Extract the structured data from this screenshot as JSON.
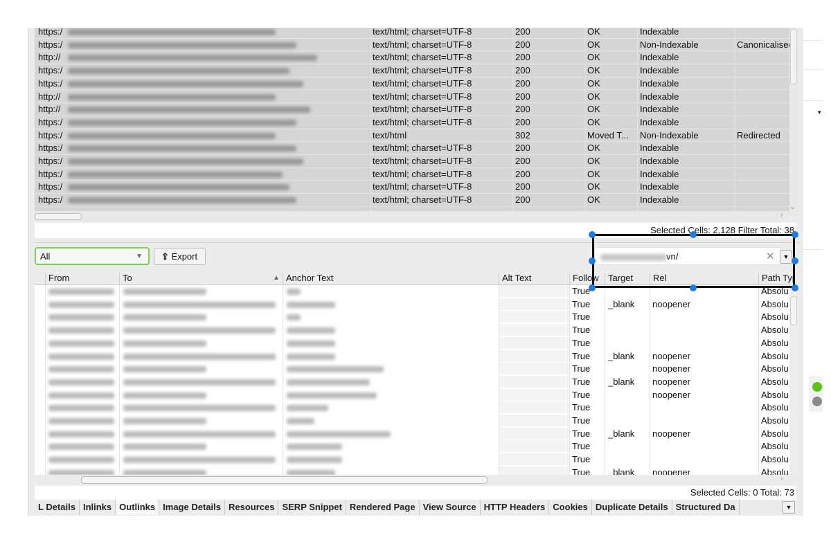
{
  "top_table": {
    "rows": [
      {
        "address": "https:/",
        "content_type": "text/html; charset=UTF-8",
        "status_code": "200",
        "status": "OK",
        "indexability": "Indexable",
        "indexability_status": ""
      },
      {
        "address": "https:/",
        "content_type": "text/html; charset=UTF-8",
        "status_code": "200",
        "status": "OK",
        "indexability": "Non-Indexable",
        "indexability_status": "Canonicalised"
      },
      {
        "address": "http://",
        "content_type": "text/html; charset=UTF-8",
        "status_code": "200",
        "status": "OK",
        "indexability": "Indexable",
        "indexability_status": ""
      },
      {
        "address": "https:/",
        "content_type": "text/html; charset=UTF-8",
        "status_code": "200",
        "status": "OK",
        "indexability": "Indexable",
        "indexability_status": ""
      },
      {
        "address": "https:/",
        "content_type": "text/html; charset=UTF-8",
        "status_code": "200",
        "status": "OK",
        "indexability": "Indexable",
        "indexability_status": ""
      },
      {
        "address": "http://",
        "content_type": "text/html; charset=UTF-8",
        "status_code": "200",
        "status": "OK",
        "indexability": "Indexable",
        "indexability_status": ""
      },
      {
        "address": "http://",
        "content_type": "text/html; charset=UTF-8",
        "status_code": "200",
        "status": "OK",
        "indexability": "Indexable",
        "indexability_status": ""
      },
      {
        "address": "https:/",
        "content_type": "text/html; charset=UTF-8",
        "status_code": "200",
        "status": "OK",
        "indexability": "Indexable",
        "indexability_status": ""
      },
      {
        "address": "https:/",
        "content_type": "text/html",
        "status_code": "302",
        "status": "Moved T...",
        "indexability": "Non-Indexable",
        "indexability_status": "Redirected"
      },
      {
        "address": "https:/",
        "content_type": "text/html; charset=UTF-8",
        "status_code": "200",
        "status": "OK",
        "indexability": "Indexable",
        "indexability_status": ""
      },
      {
        "address": "https:/",
        "content_type": "text/html; charset=UTF-8",
        "status_code": "200",
        "status": "OK",
        "indexability": "Indexable",
        "indexability_status": ""
      },
      {
        "address": "https:/",
        "content_type": "text/html; charset=UTF-8",
        "status_code": "200",
        "status": "OK",
        "indexability": "Indexable",
        "indexability_status": ""
      },
      {
        "address": "https:/",
        "content_type": "text/html; charset=UTF-8",
        "status_code": "200",
        "status": "OK",
        "indexability": "Indexable",
        "indexability_status": ""
      },
      {
        "address": "https:/",
        "content_type": "text/html; charset=UTF-8",
        "status_code": "200",
        "status": "OK",
        "indexability": "Indexable",
        "indexability_status": ""
      }
    ],
    "status_text": "Selected Cells: 2,128  Filter Total: 38"
  },
  "toolbar": {
    "filter_value": "All",
    "export_label": "Export",
    "search_value_suffix": "vn/",
    "clear_icon": "✕"
  },
  "bottom_table": {
    "columns": [
      "From",
      "To",
      "Anchor Text",
      "Alt Text",
      "Follow",
      "Target",
      "Rel",
      "Path Type"
    ],
    "sort_indicator": "▲",
    "rows": [
      {
        "follow": "True",
        "target": "",
        "rel": "",
        "path_type": "Absolu"
      },
      {
        "follow": "True",
        "target": "_blank",
        "rel": "noopener",
        "path_type": "Absolu"
      },
      {
        "follow": "True",
        "target": "",
        "rel": "",
        "path_type": "Absolu"
      },
      {
        "follow": "True",
        "target": "",
        "rel": "",
        "path_type": "Absolu"
      },
      {
        "follow": "True",
        "target": "",
        "rel": "",
        "path_type": "Absolu"
      },
      {
        "follow": "True",
        "target": "_blank",
        "rel": "noopener",
        "path_type": "Absolu"
      },
      {
        "follow": "True",
        "target": "",
        "rel": "noopener",
        "path_type": "Absolu"
      },
      {
        "follow": "True",
        "target": "_blank",
        "rel": "noopener",
        "path_type": "Absolu"
      },
      {
        "follow": "True",
        "target": "",
        "rel": "noopener",
        "path_type": "Absolu"
      },
      {
        "follow": "True",
        "target": "",
        "rel": "",
        "path_type": "Absolu"
      },
      {
        "follow": "True",
        "target": "",
        "rel": "",
        "path_type": "Absolu"
      },
      {
        "follow": "True",
        "target": "_blank",
        "rel": "noopener",
        "path_type": "Absolu"
      },
      {
        "follow": "True",
        "target": "",
        "rel": "",
        "path_type": "Absolu"
      },
      {
        "follow": "True",
        "target": "",
        "rel": "",
        "path_type": "Absolu"
      },
      {
        "follow": "True",
        "target": "_blank",
        "rel": "noopener",
        "path_type": "Absolu"
      }
    ],
    "status_text": "Selected Cells:  0  Total:  73"
  },
  "tabs": [
    "L Details",
    "Inlinks",
    "Outlinks",
    "Image Details",
    "Resources",
    "SERP Snippet",
    "Rendered Page",
    "View Source",
    "HTTP Headers",
    "Cookies",
    "Duplicate Details",
    "Structured Da"
  ],
  "active_tab": "Outlinks",
  "colors": {
    "accent_green": "#7ccf5a",
    "selection_handle": "#1e7be0",
    "status_green": "#5cc21a",
    "status_gray": "#8c8c8c"
  }
}
